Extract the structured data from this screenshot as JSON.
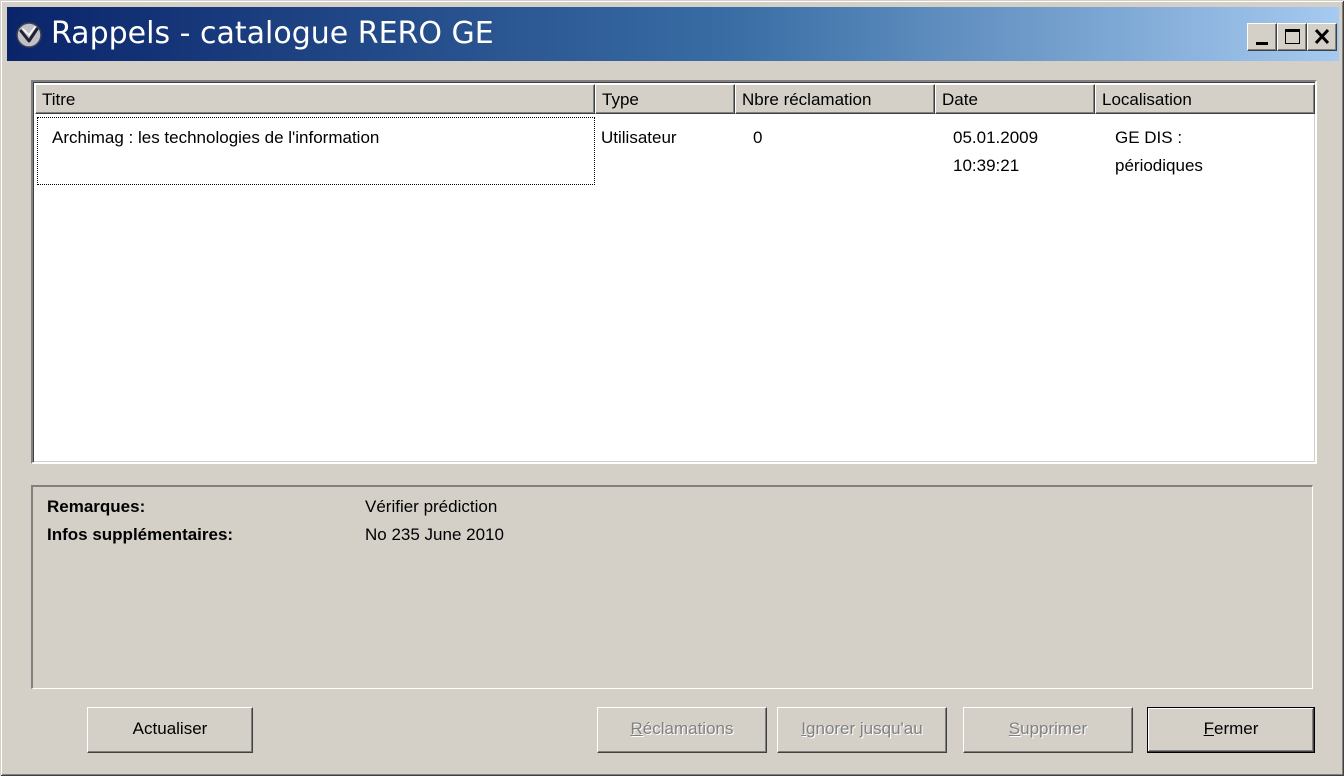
{
  "window": {
    "title": "Rappels - catalogue RERO GE"
  },
  "list": {
    "columns": [
      "Titre",
      "Type",
      "Nbre réclamation",
      "Date",
      "Localisation"
    ],
    "rows": [
      {
        "titre": "Archimag : les technologies de l'information",
        "type": "Utilisateur",
        "nbre": "0",
        "date": "05.01.2009\n10:39:21",
        "localisation": "GE DIS :\npériodiques"
      }
    ]
  },
  "details": {
    "remarques_label": "Remarques:",
    "remarques_value": "Vérifier prédiction",
    "infos_label": "Infos supplémentaires:",
    "infos_value": "No 235 June 2010"
  },
  "buttons": {
    "actualiser": "Actualiser",
    "reclamations_first": "R",
    "reclamations_rest": "éclamations",
    "ignorer_first": "I",
    "ignorer_rest": "gnorer jusqu'au",
    "supprimer_first": "S",
    "supprimer_rest": "upprimer",
    "fermer_first": "F",
    "fermer_rest": "ermer"
  }
}
